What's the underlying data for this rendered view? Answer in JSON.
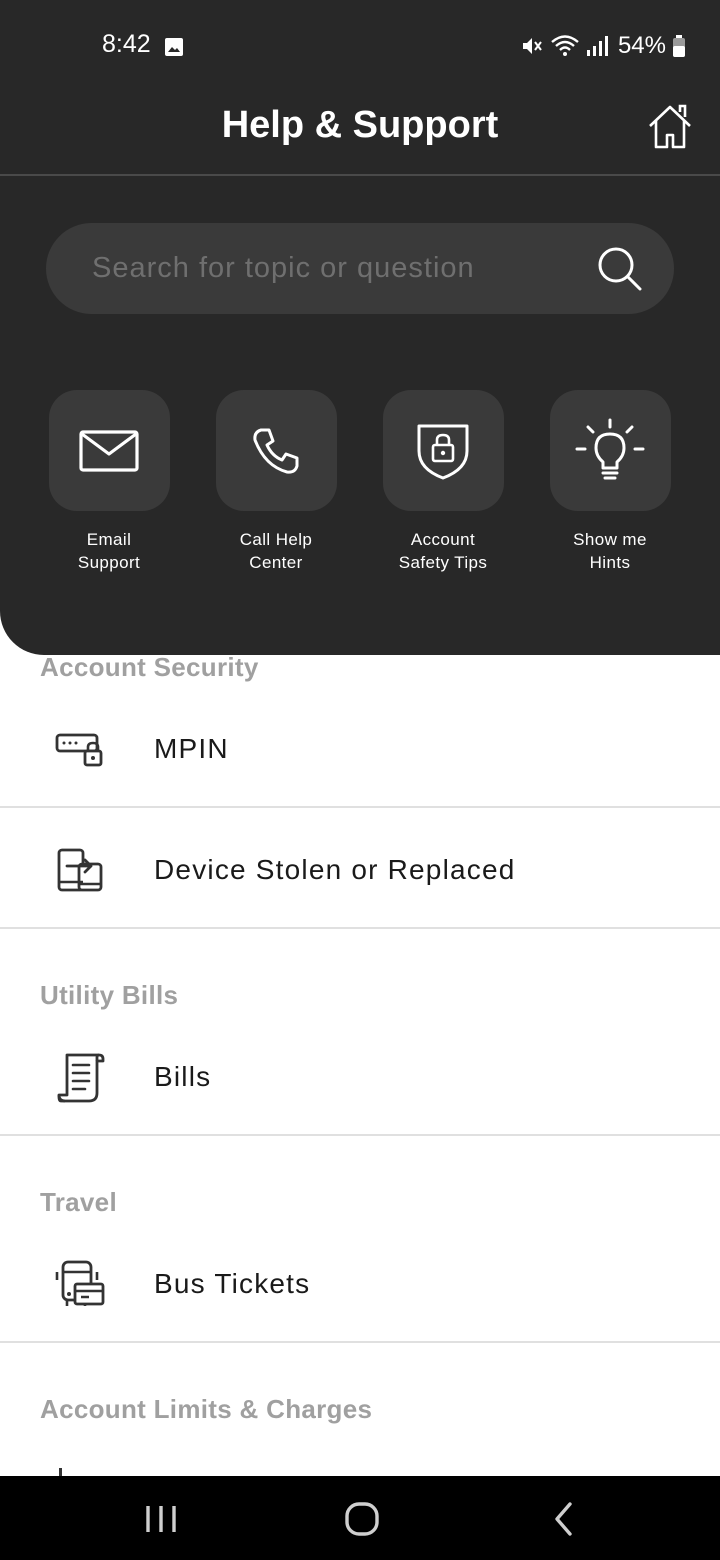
{
  "status_bar": {
    "time": "8:42",
    "battery_percent": "54%",
    "icons": [
      "image-icon",
      "mute-icon",
      "wifi-icon",
      "signal-icon",
      "battery-icon"
    ]
  },
  "header": {
    "title": "Help & Support",
    "home_icon": "home-icon"
  },
  "search": {
    "placeholder": "Search for topic or question",
    "icon": "search-icon"
  },
  "quick_actions": [
    {
      "label": "Email\nSupport",
      "icon": "mail-icon"
    },
    {
      "label": "Call Help\nCenter",
      "icon": "phone-icon"
    },
    {
      "label": "Account\nSafety Tips",
      "icon": "shield-lock-icon"
    },
    {
      "label": "Show me\nHints",
      "icon": "lightbulb-icon"
    }
  ],
  "sections": [
    {
      "title": "Account Security",
      "items": [
        {
          "label": "MPIN",
          "icon": "pin-lock-icon"
        },
        {
          "label": "Device Stolen or Replaced",
          "icon": "device-switch-icon"
        }
      ]
    },
    {
      "title": "Utility Bills",
      "items": [
        {
          "label": "Bills",
          "icon": "receipt-icon"
        }
      ]
    },
    {
      "title": "Travel",
      "items": [
        {
          "label": "Bus Tickets",
          "icon": "bus-ticket-icon"
        }
      ]
    },
    {
      "title": "Account Limits & Charges",
      "items": []
    }
  ],
  "nav_bar": {
    "buttons": [
      "recent-apps-icon",
      "home-circle-icon",
      "back-icon"
    ]
  },
  "colors": {
    "header_bg": "#282828",
    "tile_bg": "#3a3a3a",
    "section_title": "#a0a0a0",
    "divider": "#e0e0e0"
  }
}
